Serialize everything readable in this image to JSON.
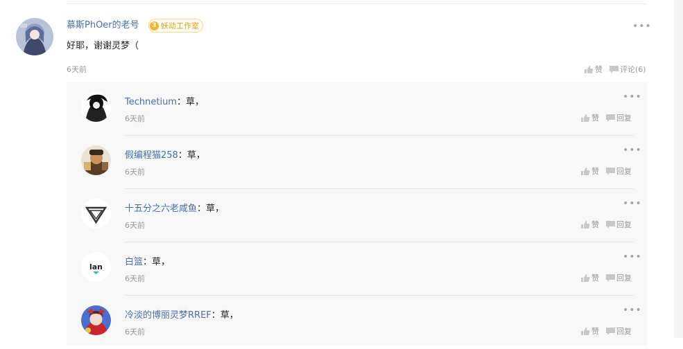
{
  "comment": {
    "author": "慕斯PhOer的老号",
    "badge_level": "3",
    "badge_label": "妖动工作室",
    "text": "好耶，谢谢灵梦（",
    "time": "6天前",
    "like_label": "赞",
    "comment_label": "评论(6)",
    "more_icon": "•••"
  },
  "replies": [
    {
      "user": "Technetium",
      "content": "：草，",
      "time": "6天前",
      "like_label": "赞",
      "reply_label": "回复",
      "more_icon": "•••"
    },
    {
      "user": "假编程猫258",
      "content": "：草，",
      "time": "6天前",
      "like_label": "赞",
      "reply_label": "回复",
      "more_icon": "•••"
    },
    {
      "user": "十五分之六老咸鱼",
      "content": "：草，",
      "time": "6天前",
      "like_label": "赞",
      "reply_label": "回复",
      "more_icon": "•••"
    },
    {
      "user": "白篮",
      "content": "：草，",
      "time": "6天前",
      "like_label": "赞",
      "reply_label": "回复",
      "more_icon": "•••",
      "avatar_text": "lan"
    },
    {
      "user": "冷淡的博丽灵梦RREF",
      "content": "：草，",
      "time": "6天前",
      "like_label": "赞",
      "reply_label": "回复",
      "more_icon": "•••"
    }
  ],
  "colors": {
    "link": "#4a6ea9",
    "muted": "#999999",
    "badge": "#f2b52b",
    "reply_bg": "#f8f8f8"
  }
}
